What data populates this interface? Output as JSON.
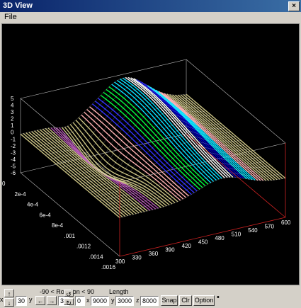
{
  "window": {
    "title": "3D View",
    "close_glyph": "×"
  },
  "menu": {
    "file": "File"
  },
  "plot": {
    "z_ticks": [
      "5",
      "4",
      "3",
      "2",
      "1",
      "0",
      "-1",
      "-2",
      "-3",
      "-4",
      "-5",
      "-6"
    ],
    "y_ticks": [
      "0",
      "2e-4",
      "4e-4",
      "6e-4",
      "8e-4",
      ".001",
      ".0012",
      ".0014",
      ".0016"
    ],
    "x_ticks": [
      "300",
      "330",
      "360",
      "390",
      "420",
      "450",
      "480",
      "510",
      "540",
      "570",
      "600"
    ],
    "surface_colors": [
      "#c8c080",
      "#b050b0",
      "#ffb0b0",
      "#3030ff",
      "#00e0ff",
      "#00ff40",
      "#ffffff",
      "#0000c0",
      "#0000a0"
    ]
  },
  "controls": {
    "rotation_label": "-90 < Rotation < 90",
    "length_label": "Length",
    "x_label": "x",
    "y_label": "y",
    "z_label": "z",
    "rot_x_value": "30",
    "rot_y_value": "30",
    "rot_z_value": "0",
    "len_x_value": "9000",
    "len_y_value": "3000",
    "len_z_value": "8000",
    "snap_label": "Snap",
    "clr_label": "Clr",
    "option_label": "Option",
    "up_glyph": "↑",
    "down_glyph": "↓",
    "left_glyph": "←",
    "right_glyph": "→",
    "rot_ccw_glyph": "↺",
    "rot_cw_glyph": "↻",
    "indicator_glyph": "•"
  }
}
